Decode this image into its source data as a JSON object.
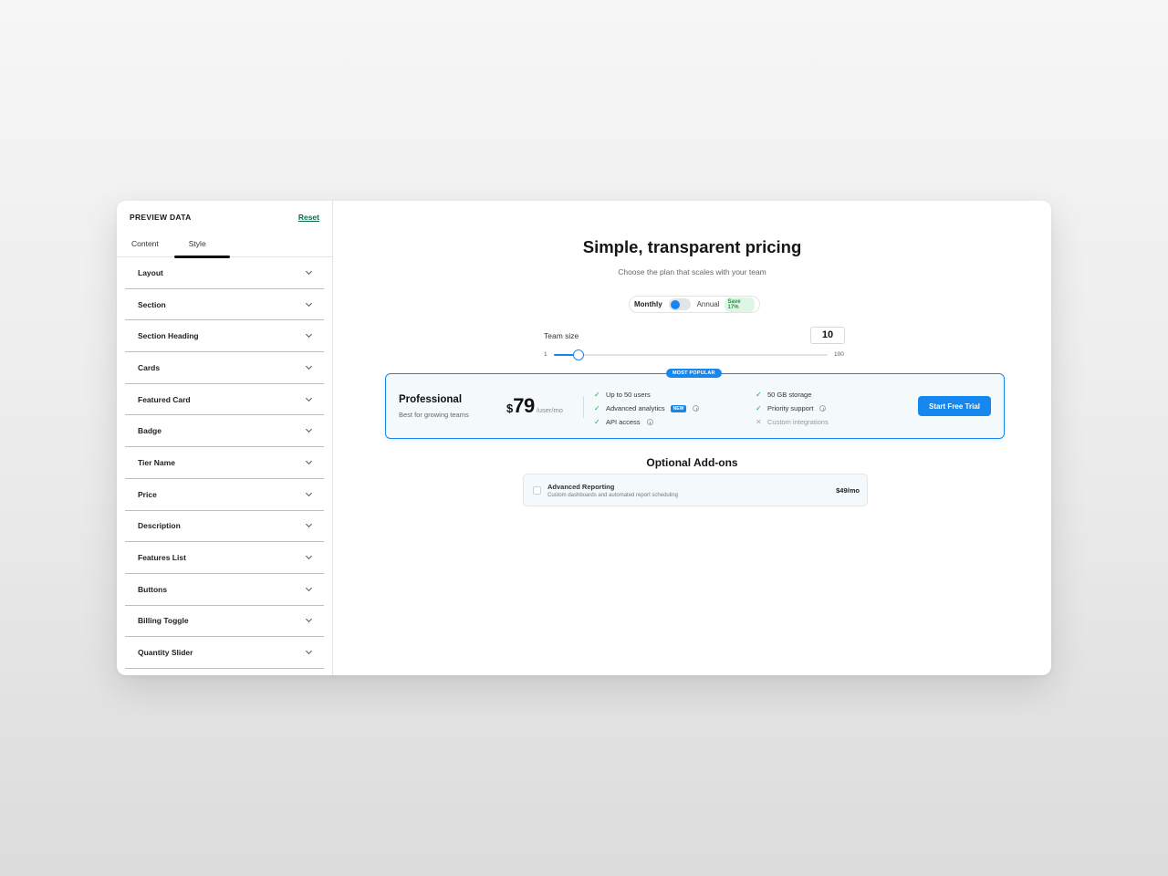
{
  "sidebar": {
    "title": "PREVIEW DATA",
    "reset_label": "Reset",
    "tabs": [
      {
        "label": "Content",
        "active": false
      },
      {
        "label": "Style",
        "active": true
      }
    ],
    "sections": [
      "Layout",
      "Section",
      "Section Heading",
      "Cards",
      "Featured Card",
      "Badge",
      "Tier Name",
      "Price",
      "Description",
      "Features List",
      "Buttons",
      "Billing Toggle",
      "Quantity Slider"
    ]
  },
  "pricing": {
    "title": "Simple, transparent pricing",
    "subtitle": "Choose the plan that scales with your team",
    "billing": {
      "monthly_label": "Monthly",
      "annual_label": "Annual",
      "save_badge": "Save 17%",
      "annual_selected": false
    },
    "team": {
      "label": "Team size",
      "value": "10",
      "min": "1",
      "max": "100",
      "slider_value": 10,
      "slider_min": 1,
      "slider_max": 100
    },
    "featured": {
      "badge": "MOST POPULAR",
      "name": "Professional",
      "description": "Best for growing teams",
      "currency": "$",
      "price": "79",
      "unit": "/user/mo",
      "features_left": [
        {
          "text": "Up to 50 users",
          "included": true
        },
        {
          "text": "Advanced analytics",
          "included": true,
          "badge": "NEW",
          "info": true
        },
        {
          "text": "API access",
          "included": true,
          "info": true
        }
      ],
      "features_right": [
        {
          "text": "50 GB storage",
          "included": true
        },
        {
          "text": "Priority support",
          "included": true,
          "info": true
        },
        {
          "text": "Custom integrations",
          "included": false
        }
      ],
      "cta": "Start Free Trial"
    },
    "addons": {
      "title": "Optional Add-ons",
      "items": [
        {
          "name": "Advanced Reporting",
          "description": "Custom dashboards and automated report scheduling",
          "price": "$49/mo",
          "checked": false
        }
      ]
    }
  },
  "colors": {
    "accent": "#1787f0",
    "check": "#1aa34a",
    "reset_link": "#0d6b4f"
  }
}
